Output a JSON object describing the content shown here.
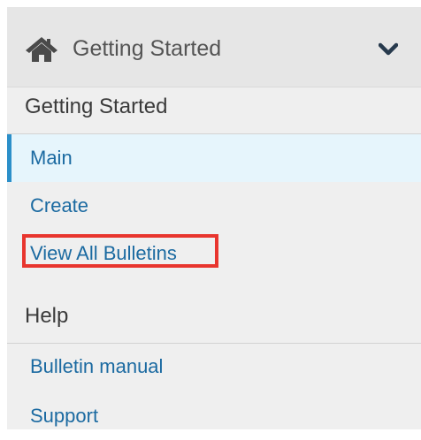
{
  "header": {
    "icon": "home-icon",
    "title": "Getting Started",
    "toggle_icon": "chevron-down-icon"
  },
  "sections": [
    {
      "heading": "Getting Started",
      "items": [
        {
          "label": "Main",
          "active": true
        },
        {
          "label": "Create",
          "active": false
        },
        {
          "label": "View All Bulletins",
          "active": false,
          "highlighted": true
        }
      ]
    },
    {
      "heading": "Help",
      "items": [
        {
          "label": "Bulletin manual",
          "active": false
        },
        {
          "label": "Support",
          "active": false
        }
      ]
    }
  ],
  "colors": {
    "link": "#1b6aa1",
    "active_background": "#e6f5fc",
    "active_accent": "#2b8fc9",
    "highlight_border": "#e8352e"
  }
}
